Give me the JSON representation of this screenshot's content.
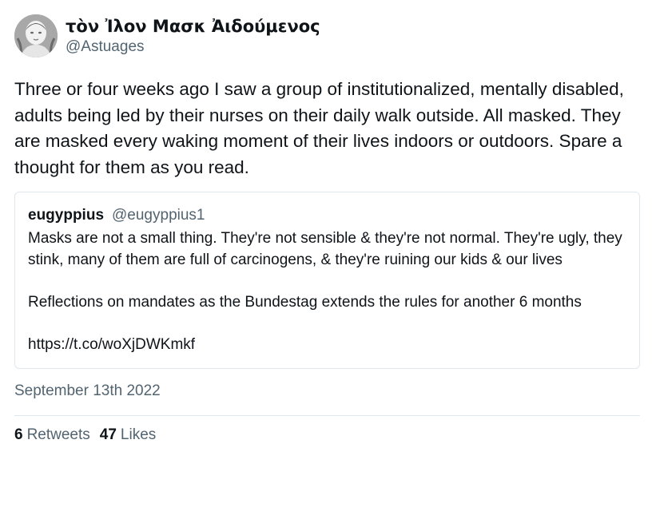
{
  "author": {
    "display_name": "τὸν Ἰλον Μασκ Ἀιδούμενος",
    "handle": "@Astuages",
    "avatar_icon": "classical-bust-avatar"
  },
  "tweet": {
    "text": "Three or four weeks ago I saw a group of institutionalized, mentally disabled, adults being led by their nurses on their daily walk outside. All masked. They are masked every waking moment of their lives indoors or outdoors. Spare a thought for them as you read.",
    "date": "September 13th 2022"
  },
  "quoted_tweet": {
    "name": "eugyppius",
    "handle": "@eugyppius1",
    "paragraphs": [
      "Masks are not a small thing. They're not sensible & they're not normal. They're ugly, they stink, many of them are full of carcinogens, & they're ruining our kids & our lives",
      "Reflections on mandates as the Bundestag extends the rules for another 6 months",
      "https://t.co/woXjDWKmkf"
    ]
  },
  "stats": {
    "retweets_count": "6",
    "retweets_label": "Retweets",
    "likes_count": "47",
    "likes_label": "Likes"
  },
  "colors": {
    "text": "#0f1419",
    "secondary": "#536471",
    "border": "#e1e8ed"
  }
}
